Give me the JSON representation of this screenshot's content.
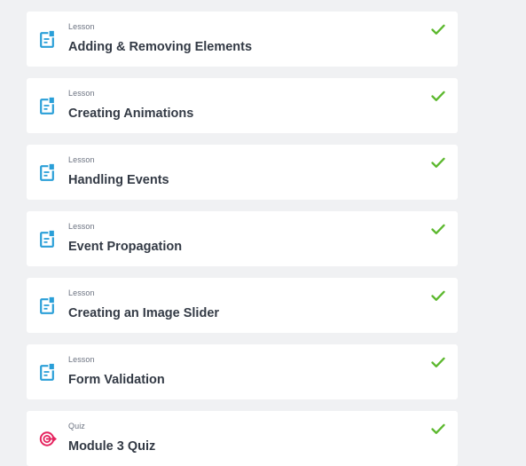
{
  "colors": {
    "background": "#f0f1f3",
    "card": "#ffffff",
    "lesson_icon": "#2a9fd8",
    "quiz_icon": "#e5245f",
    "check": "#5cb82e",
    "title": "#333a45",
    "type_label": "#6b7280"
  },
  "items": [
    {
      "type": "Lesson",
      "title": "Adding & Removing Elements",
      "icon": "lesson-document-icon",
      "completed": true
    },
    {
      "type": "Lesson",
      "title": "Creating Animations",
      "icon": "lesson-document-icon",
      "completed": true
    },
    {
      "type": "Lesson",
      "title": "Handling Events",
      "icon": "lesson-document-icon",
      "completed": true
    },
    {
      "type": "Lesson",
      "title": "Event Propagation",
      "icon": "lesson-document-icon",
      "completed": true
    },
    {
      "type": "Lesson",
      "title": "Creating an Image Slider",
      "icon": "lesson-document-icon",
      "completed": true
    },
    {
      "type": "Lesson",
      "title": "Form Validation",
      "icon": "lesson-document-icon",
      "completed": true
    },
    {
      "type": "Quiz",
      "title": "Module 3 Quiz",
      "icon": "quiz-target-icon",
      "completed": true
    }
  ]
}
